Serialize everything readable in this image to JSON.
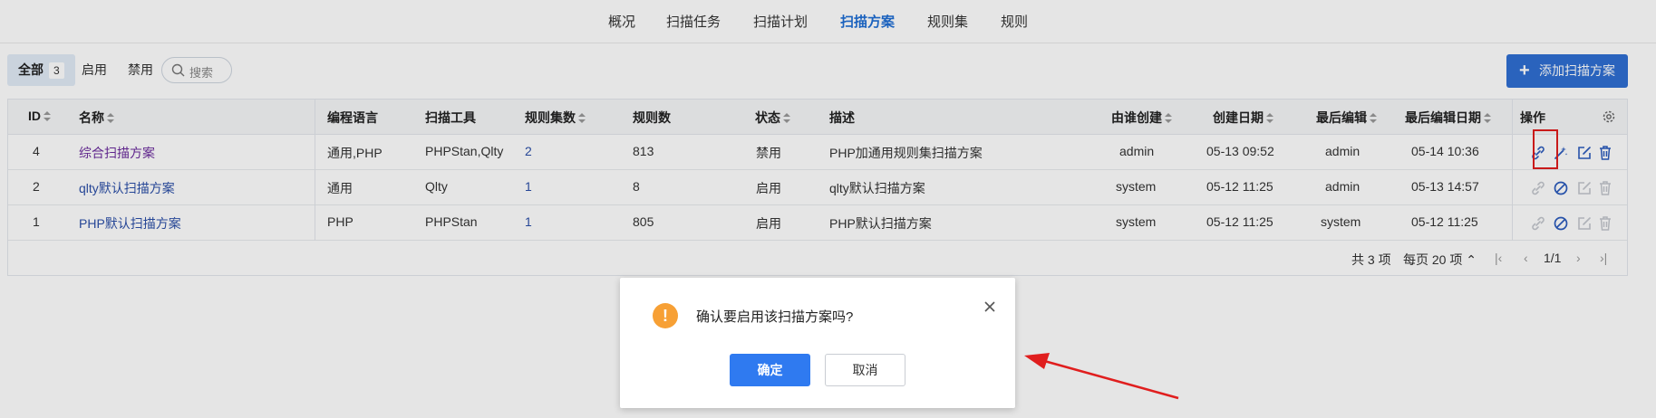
{
  "nav": {
    "tabs": [
      {
        "label": "概况"
      },
      {
        "label": "扫描任务"
      },
      {
        "label": "扫描计划"
      },
      {
        "label": "扫描方案"
      },
      {
        "label": "规则集"
      },
      {
        "label": "规则"
      }
    ],
    "active": "扫描方案"
  },
  "filter": {
    "all_label": "全部",
    "all_count": "3",
    "enabled_label": "启用",
    "disabled_label": "禁用",
    "search_placeholder": "搜索"
  },
  "add_button": {
    "label": "添加扫描方案",
    "icon": "plus-icon"
  },
  "table": {
    "headers": {
      "id": "ID",
      "name": "名称",
      "lang": "编程语言",
      "tool": "扫描工具",
      "ruleset_count": "规则集数",
      "rule_count": "规则数",
      "status": "状态",
      "desc": "描述",
      "creator": "由谁创建",
      "created": "创建日期",
      "editor": "最后编辑",
      "edited": "最后编辑日期",
      "ops": "操作"
    },
    "rows": [
      {
        "id": "4",
        "name": "综合扫描方案",
        "lang": "通用,PHP",
        "tool": "PHPStan,Qlty",
        "ruleset_count": "2",
        "rule_count": "813",
        "status": "禁用",
        "desc": "PHP加通用规则集扫描方案",
        "creator": "admin",
        "created": "05-13 09:52",
        "editor": "admin",
        "edited": "05-14 10:36"
      },
      {
        "id": "2",
        "name": "qlty默认扫描方案",
        "lang": "通用",
        "tool": "Qlty",
        "ruleset_count": "1",
        "rule_count": "8",
        "status": "启用",
        "desc": "qlty默认扫描方案",
        "creator": "system",
        "created": "05-12 11:25",
        "editor": "admin",
        "edited": "05-13 14:57"
      },
      {
        "id": "1",
        "name": "PHP默认扫描方案",
        "lang": "PHP",
        "tool": "PHPStan",
        "ruleset_count": "1",
        "rule_count": "805",
        "status": "启用",
        "desc": "PHP默认扫描方案",
        "creator": "system",
        "created": "05-12 11:25",
        "editor": "system",
        "edited": "05-12 11:25"
      }
    ],
    "footer": {
      "total": "共 3 项",
      "per_page": "每页 20 项",
      "page": "1/1"
    }
  },
  "dialog": {
    "message": "确认要启用该扫描方案吗?",
    "ok_label": "确定",
    "cancel_label": "取消"
  },
  "colors": {
    "accent": "#2f6fd3",
    "link": "#2b4fa8",
    "warning": "#f7a035",
    "highlight": "#e01e1e"
  }
}
